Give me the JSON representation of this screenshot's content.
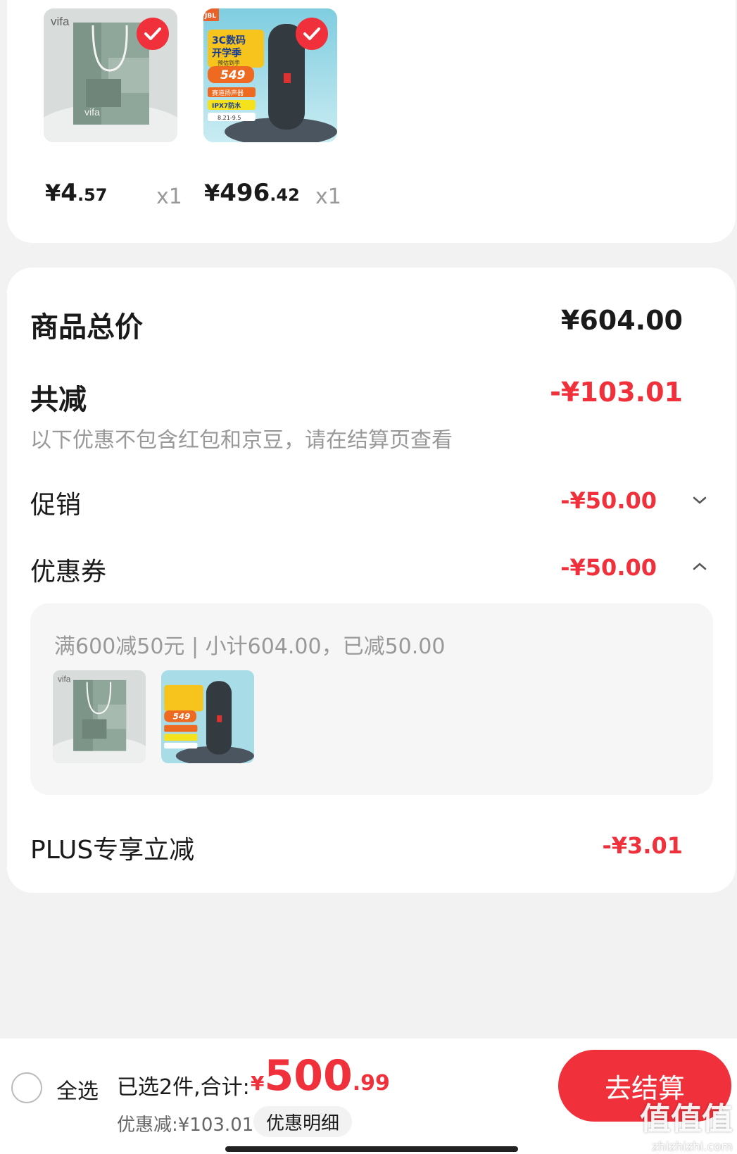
{
  "cart_items": [
    {
      "brand_mark": "vifa",
      "brand_mark_lower": "vifa",
      "price_currency": "¥",
      "price_int": "4",
      "price_dec": ".57",
      "qty": "x1"
    },
    {
      "brand_mark": "JBL",
      "promo_line1": "3C数码",
      "promo_line2": "开学季",
      "promo_small": "预估到手",
      "promo_price": "549",
      "promo_tag1": "赛道扬声器",
      "promo_tag2": "IPX7防水",
      "promo_dates": "8.21-9.5",
      "price_currency": "¥",
      "price_int": "496",
      "price_dec": ".42",
      "qty": "x1"
    }
  ],
  "summary": {
    "total_label": "商品总价",
    "total_value": "¥604.00",
    "discount_label": "共减",
    "discount_value": "-¥103.01",
    "discount_note": "以下优惠不包含红包和京豆，请在结算页查看",
    "promo_label": "促销",
    "promo_value": "-¥50.00",
    "coupon_label": "优惠券",
    "coupon_value": "-¥50.00",
    "coupon_detail": "满600减50元 | 小计604.00，已减50.00",
    "plus_label": "PLUS专享立减",
    "plus_value": "-¥3.01"
  },
  "bottom_bar": {
    "select_all": "全选",
    "selected_info": "已选2件,合计:",
    "total_currency": "¥",
    "total_int": "500",
    "total_dec": ".99",
    "discount_line": "优惠减:¥103.01",
    "detail_button": "优惠明细",
    "checkout_button": "去结算"
  },
  "watermark": {
    "main": "值值值",
    "sub": "zhizhizhi.com"
  },
  "colors": {
    "accent_red": "#f0303a",
    "muted_text": "#999999",
    "background": "#f2f2f2"
  }
}
